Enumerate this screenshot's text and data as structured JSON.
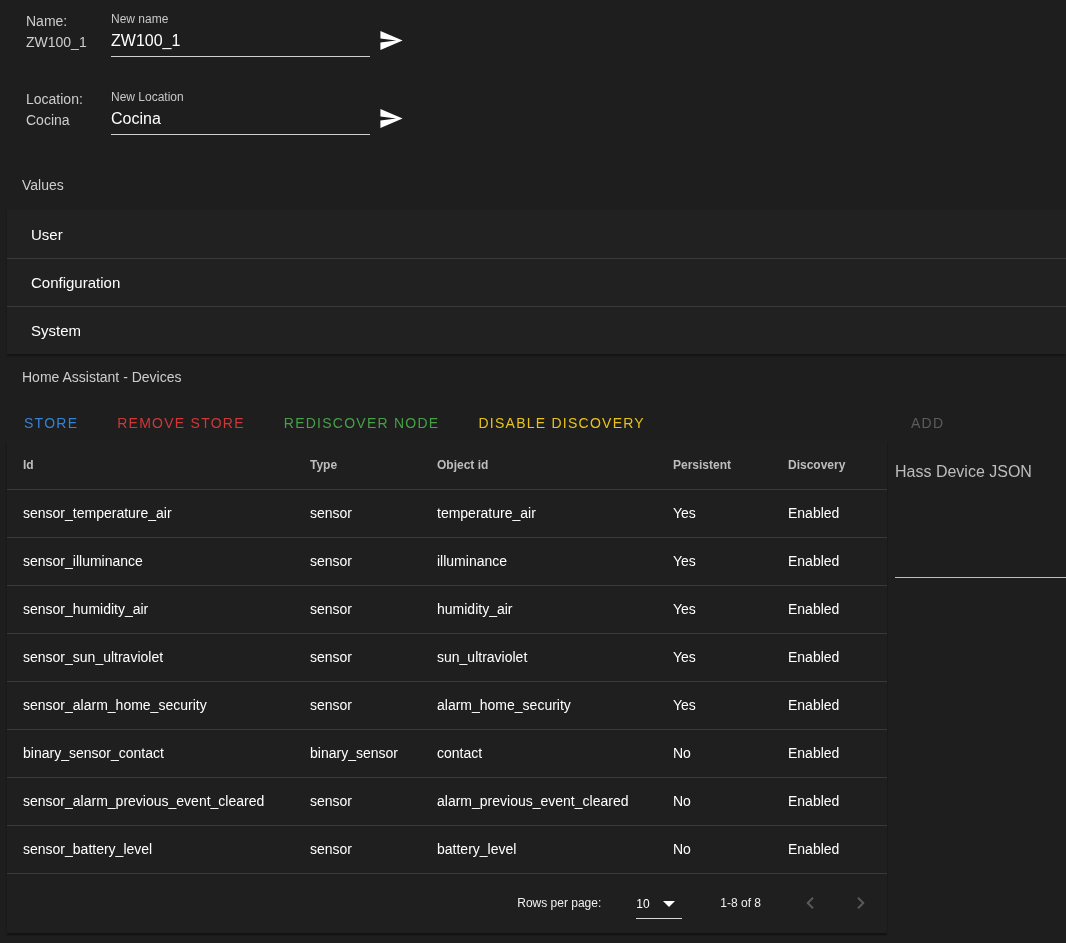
{
  "device": {
    "fields": [
      {
        "label": "Name:",
        "current": "ZW100_1",
        "field_label": "New name",
        "value": "ZW100_1"
      },
      {
        "label": "Location:",
        "current": "Cocina",
        "field_label": "New Location",
        "value": "Cocina"
      }
    ]
  },
  "values": {
    "title": "Values",
    "groups": [
      "User",
      "Configuration",
      "System"
    ]
  },
  "hass_devices": {
    "title": "Home Assistant - Devices",
    "actions": [
      {
        "label": "STORE",
        "color": "#3483d8"
      },
      {
        "label": "REMOVE STORE",
        "color": "#d03838"
      },
      {
        "label": "REDISCOVER NODE",
        "color": "#46a048"
      },
      {
        "label": "DISABLE DISCOVERY",
        "color": "#e8c31c"
      }
    ],
    "add_button": {
      "label": "ADD",
      "disabled": true
    },
    "table": {
      "columns": [
        "Id",
        "Type",
        "Object id",
        "Persistent",
        "Discovery"
      ],
      "rows": [
        [
          "sensor_temperature_air",
          "sensor",
          "temperature_air",
          "Yes",
          "Enabled"
        ],
        [
          "sensor_illuminance",
          "sensor",
          "illuminance",
          "Yes",
          "Enabled"
        ],
        [
          "sensor_humidity_air",
          "sensor",
          "humidity_air",
          "Yes",
          "Enabled"
        ],
        [
          "sensor_sun_ultraviolet",
          "sensor",
          "sun_ultraviolet",
          "Yes",
          "Enabled"
        ],
        [
          "sensor_alarm_home_security",
          "sensor",
          "alarm_home_security",
          "Yes",
          "Enabled"
        ],
        [
          "binary_sensor_contact",
          "binary_sensor",
          "contact",
          "No",
          "Enabled"
        ],
        [
          "sensor_alarm_previous_event_cleared",
          "sensor",
          "alarm_previous_event_cleared",
          "No",
          "Enabled"
        ],
        [
          "sensor_battery_level",
          "sensor",
          "battery_level",
          "No",
          "Enabled"
        ]
      ]
    },
    "pagination": {
      "rows_per_page_label": "Rows per page:",
      "rows_per_page": "10",
      "range": "1-8 of 8",
      "previous": {
        "disabled": true
      },
      "next": {
        "disabled": true
      }
    },
    "json_field": {
      "placeholder": "Hass Device JSON"
    }
  }
}
